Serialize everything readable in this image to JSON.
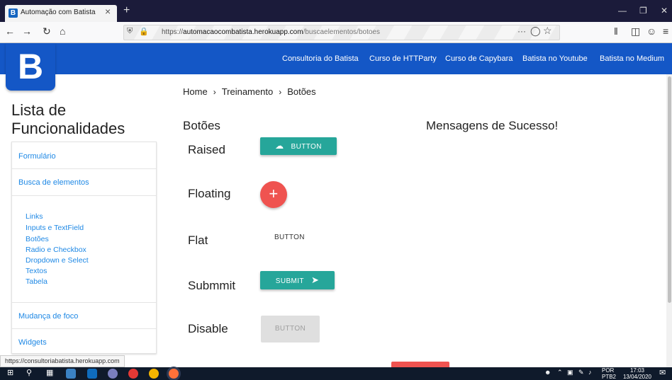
{
  "browser": {
    "tab_title": "Automação com Batista",
    "tab_favicon": "B",
    "tab_close": "×",
    "new_tab": "+",
    "url_scheme": "https://",
    "url_host": "automacaocombatista.herokuapp.com",
    "url_path": "/buscaelementos/botoes",
    "page_actions": "···",
    "status_url": "https://consultoriabatista.herokuapp.com"
  },
  "site": {
    "logo": "B",
    "nav": [
      "Consultoria do Batista",
      "Curso de HTTParty",
      "Curso de Capybara",
      "Batista no Youtube",
      "Batista no Medium"
    ]
  },
  "breadcrumb": [
    "Home",
    "Treinamento",
    "Botões"
  ],
  "breadcrumb_sep": "›",
  "sidebar": {
    "title": "Lista de Funcionalidades",
    "items": [
      "Formulário",
      "Busca de elementos",
      "Mudança de foco",
      "Widgets"
    ],
    "subitems": [
      "Links",
      "Inputs e TextField",
      "Botões",
      "Radio e Checkbox",
      "Dropdown e Select",
      "Textos",
      "Tabela"
    ]
  },
  "main": {
    "section_title": "Botões",
    "messages_title": "Mensagens de Sucesso!",
    "rows": [
      {
        "label": "Raised",
        "button": "BUTTON",
        "icon": "cloud-icon"
      },
      {
        "label": "Floating",
        "button": "+",
        "icon": "plus-icon"
      },
      {
        "label": "Flat",
        "button": "BUTTON"
      },
      {
        "label": "Submmit",
        "button": "SUBMIT",
        "icon": "send-icon"
      },
      {
        "label": "Disable",
        "button": "BUTTON"
      }
    ]
  },
  "taskbar": {
    "lang": "POR",
    "lang2": "PTB2",
    "time": "17:03",
    "date": "13/04/2020"
  },
  "colors": {
    "brand": "#1457c6",
    "teal": "#26a69a",
    "red": "#ef5350",
    "link": "#1e88e5"
  }
}
